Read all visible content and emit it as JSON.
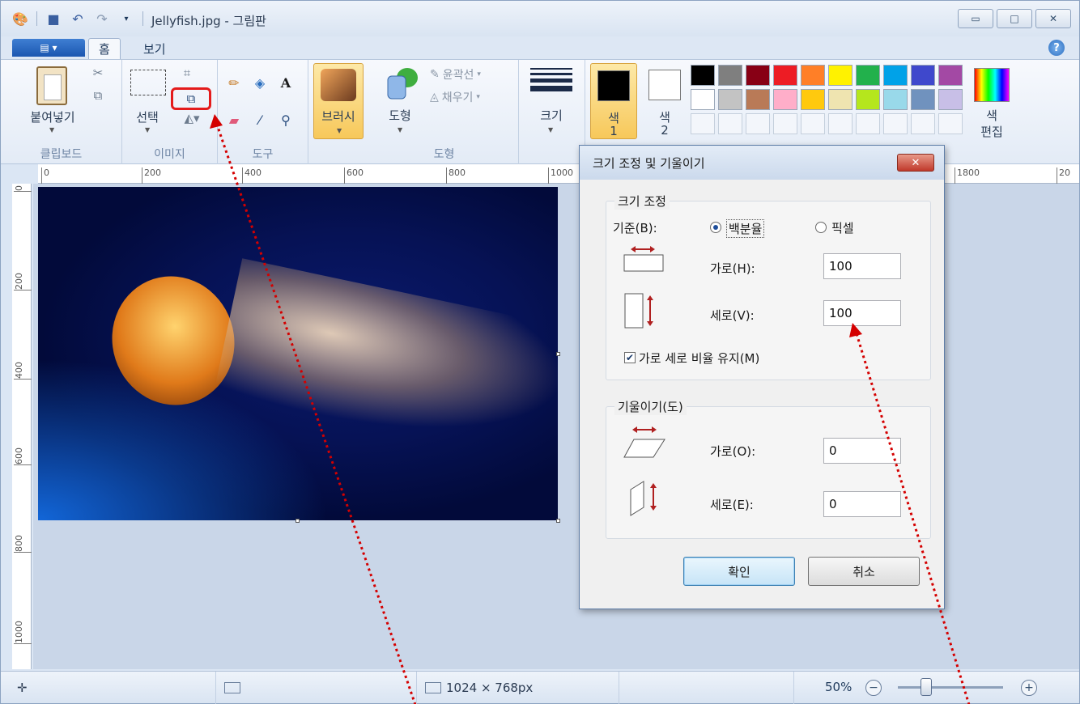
{
  "window": {
    "title": "Jellyfish.jpg - 그림판",
    "buttons": [
      "minimize",
      "maximize",
      "close"
    ]
  },
  "tabs": [
    {
      "label": "홈",
      "active": true
    },
    {
      "label": "보기",
      "active": false
    }
  ],
  "ribbon": {
    "clipboard": {
      "paste_label": "붙여넣기",
      "group_label": "클립보드"
    },
    "image": {
      "select_label": "선택",
      "group_label": "이미지"
    },
    "tools": {
      "group_label": "도구"
    },
    "brush": {
      "label": "브러시"
    },
    "shapes": {
      "shape_label": "도형",
      "outline_label": "윤곽선",
      "fill_label": "채우기",
      "group_label": "도형"
    },
    "size": {
      "label": "크기"
    },
    "color1": {
      "label1": "색",
      "label2": "1",
      "value": "#000000"
    },
    "color2": {
      "label1": "색",
      "label2": "2",
      "value": "#ffffff"
    },
    "edit_colors": {
      "label1": "색",
      "label2": "편집"
    },
    "palette": [
      "#000000",
      "#7f7f7f",
      "#880015",
      "#ed1c24",
      "#ff7f27",
      "#fff200",
      "#22b14c",
      "#00a2e8",
      "#3f48cc",
      "#a349a4",
      "#ffffff",
      "#c3c3c3",
      "#b97a57",
      "#ffaec9",
      "#ffc90e",
      "#efe4b0",
      "#b5e61d",
      "#99d9ea",
      "#7092be",
      "#c8bfe7"
    ]
  },
  "ruler": {
    "top_ticks": [
      "0",
      "200",
      "400",
      "600",
      "800",
      "1000",
      "1800",
      "20"
    ],
    "left_ticks": [
      "0",
      "200",
      "400",
      "600",
      "800",
      "1000"
    ]
  },
  "status": {
    "dimensions": "1024 × 768px",
    "zoom": "50%"
  },
  "dialog": {
    "title": "크기 조정 및 기울이기",
    "resize_legend": "크기 조정",
    "basis_label": "기준(B):",
    "percent_label": "백분율",
    "pixel_label": "픽셀",
    "horizontal_label": "가로(H):",
    "horizontal_value": "100",
    "vertical_label": "세로(V):",
    "vertical_value": "100",
    "keep_ratio_label": "가로 세로 비율 유지(M)",
    "keep_ratio_checked": true,
    "skew_legend": "기울이기(도)",
    "skew_h_label": "가로(O):",
    "skew_h_value": "0",
    "skew_v_label": "세로(E):",
    "skew_v_value": "0",
    "ok_label": "확인",
    "cancel_label": "취소"
  },
  "colors": {
    "highlight_box": "#e41b1b",
    "annotation_arrow": "#d40000"
  }
}
